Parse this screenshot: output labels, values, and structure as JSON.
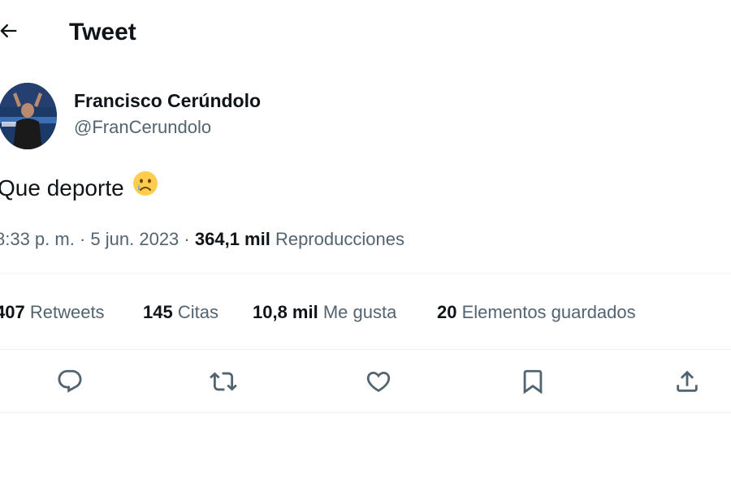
{
  "header": {
    "title": "Tweet",
    "back_icon": "arrow-left-icon"
  },
  "author": {
    "name": "Francisco Cerúndolo",
    "handle": "@FranCerundolo"
  },
  "tweet": {
    "text": "Que deporte",
    "emoji": "😢",
    "emoji_icon": "crying-face-emoji"
  },
  "meta": {
    "time": "8:33 p. m.",
    "separator": "·",
    "date": "5 jun. 2023",
    "views_count": "364,1 mil",
    "views_label": "Reproducciones"
  },
  "stats": {
    "retweets_count": "407",
    "retweets_label": "Retweets",
    "quotes_count": "145",
    "quotes_label": "Citas",
    "likes_count": "10,8 mil",
    "likes_label": "Me gusta",
    "bookmarks_count": "20",
    "bookmarks_label": "Elementos guardados"
  },
  "actions": [
    "reply-icon",
    "retweet-icon",
    "like-icon",
    "bookmark-icon",
    "share-icon"
  ],
  "colors": {
    "text_primary": "#0f1419",
    "text_secondary": "#536471",
    "divider": "#eff3f4"
  }
}
